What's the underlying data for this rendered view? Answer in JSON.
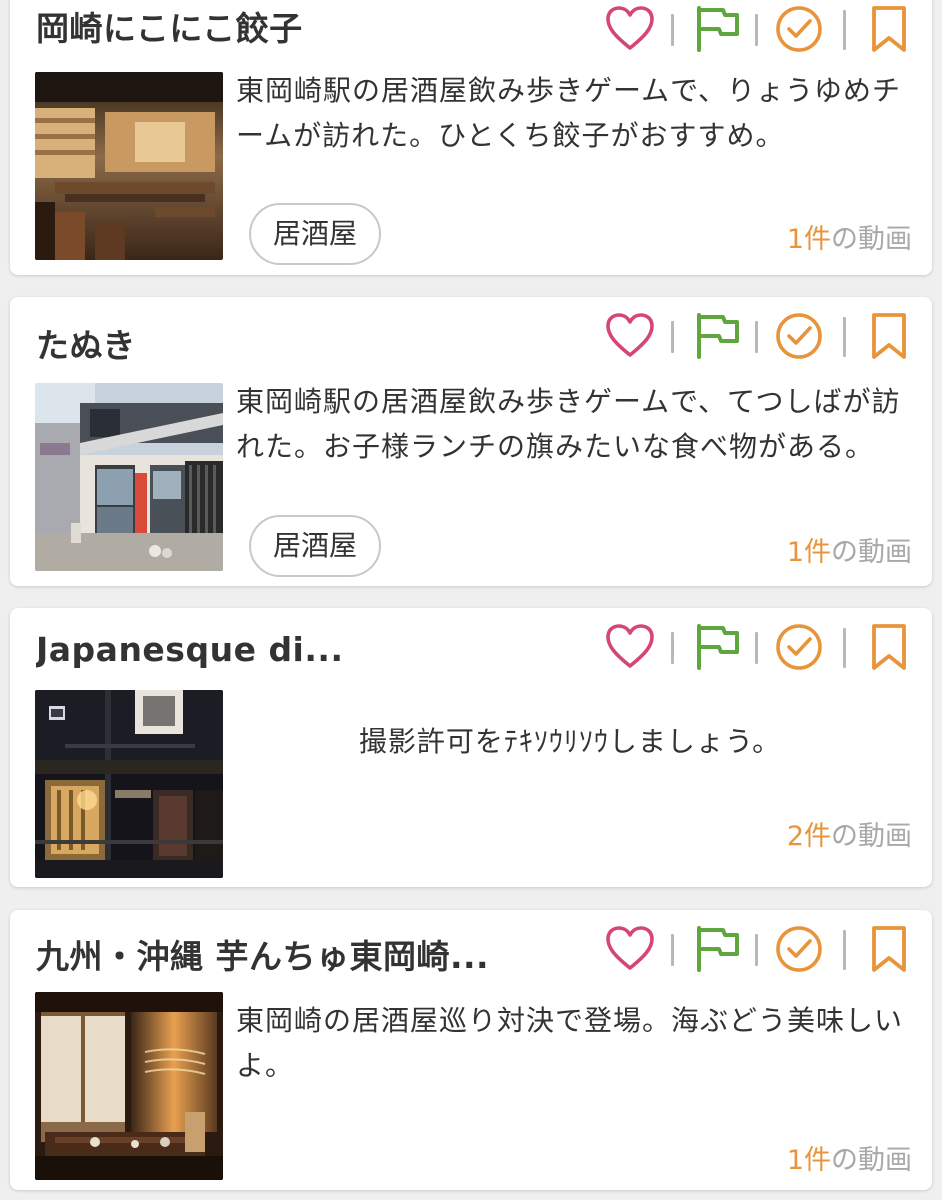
{
  "colors": {
    "heart": "#d6457a",
    "flag": "#5fa63f",
    "check": "#e8943a",
    "bookmark": "#e8943a",
    "count_accent": "#e8943a",
    "muted": "#a8a8a8"
  },
  "icons": [
    "heart-icon",
    "flag-icon",
    "check-circle-icon",
    "bookmark-icon"
  ],
  "cards": [
    {
      "title": "岡崎にこにこ餃子",
      "description": "東岡崎駅の居酒屋飲み歩きゲームで、りょうゆめチームが訪れた。ひとくち餃子がおすすめ。",
      "tag": "居酒屋",
      "video_count": "1",
      "video_unit": "件",
      "video_suffix": "の動画",
      "thumbnail": "izakaya-interior-photo"
    },
    {
      "title": "たぬき",
      "description": "東岡崎駅の居酒屋飲み歩きゲームで、てつしばが訪れた。お子様ランチの旗みたいな食べ物がある。",
      "tag": "居酒屋",
      "video_count": "1",
      "video_unit": "件",
      "video_suffix": "の動画",
      "thumbnail": "storefront-photo"
    },
    {
      "title": "Japanesque di...",
      "description": "撮影許可をﾃｷｿｳﾘｿｳしましょう。",
      "video_count": "2",
      "video_unit": "件",
      "video_suffix": "の動画",
      "thumbnail": "night-storefront-photo"
    },
    {
      "title": "九州・沖縄 芋んちゅ東岡崎...",
      "description": "東岡崎の居酒屋巡り対決で登場。海ぶどう美味しいよ。",
      "video_count": "1",
      "video_unit": "件",
      "video_suffix": "の動画",
      "thumbnail": "private-room-photo"
    }
  ]
}
